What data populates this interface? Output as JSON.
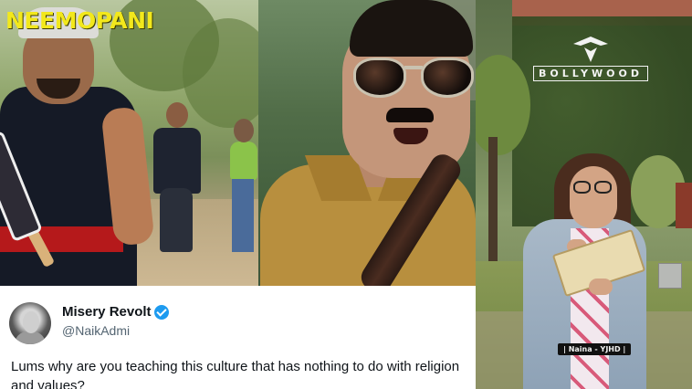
{
  "brand": {
    "name": "NEEMOPANI",
    "color": "#f2e81c"
  },
  "watermark": {
    "text": "BOLLYWOOD",
    "emblem": "crown-wings-icon"
  },
  "caption_tag": "| Naina - YJHD |",
  "tweet": {
    "display_name": "Misery Revolt",
    "verified": true,
    "verified_color": "#1d9bf0",
    "handle": "@NaikAdmi",
    "text": "Lums why are you teaching this culture that has nothing to do with religion and values?"
  }
}
